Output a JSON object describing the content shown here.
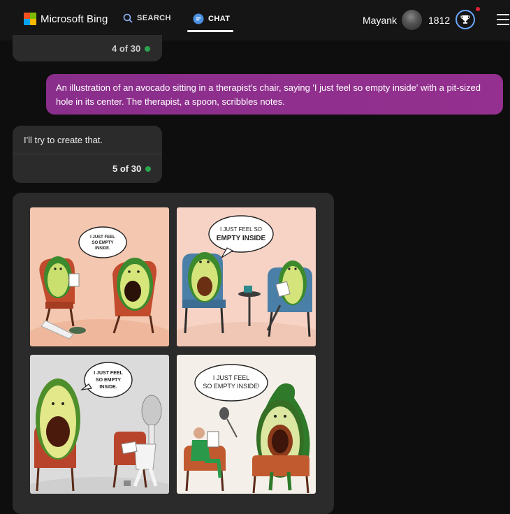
{
  "header": {
    "logo_text": "Microsoft Bing",
    "nav": [
      {
        "label": "SEARCH",
        "icon": "search-icon"
      },
      {
        "label": "CHAT",
        "icon": "chat-icon"
      }
    ],
    "user_name": "Mayank",
    "points": "1812",
    "logo_colors": [
      "#f25022",
      "#7fba00",
      "#00a4ef",
      "#ffb900"
    ]
  },
  "conversation": {
    "prev_counter": "4 of 30",
    "user_message": "An illustration of an avocado sitting in a therapist's chair, saying 'I just feel so empty inside' with a pit-sized hole in its center. The therapist, a spoon, scribbles notes.",
    "bot_message": "I'll try to create that.",
    "bot_counter": "5 of 30",
    "status_color": "#2aa44f"
  },
  "images": [
    {
      "speech": [
        "I JUST FEEL",
        "SO EMPTY",
        "INSIDE."
      ],
      "bg": "#f5c9b3"
    },
    {
      "speech": [
        "I JUST FEEL SO",
        "EMPTY INSIDE"
      ],
      "bg": "#f6d2c4"
    },
    {
      "speech": [
        "I JUST FEEL",
        "SO EMPTY",
        "INSIDE."
      ],
      "bg": "#dcdcdc"
    },
    {
      "speech": [
        "I JUST FEEL",
        "SO EMPTY INSIDE!"
      ],
      "bg": "#f3efe8"
    }
  ]
}
